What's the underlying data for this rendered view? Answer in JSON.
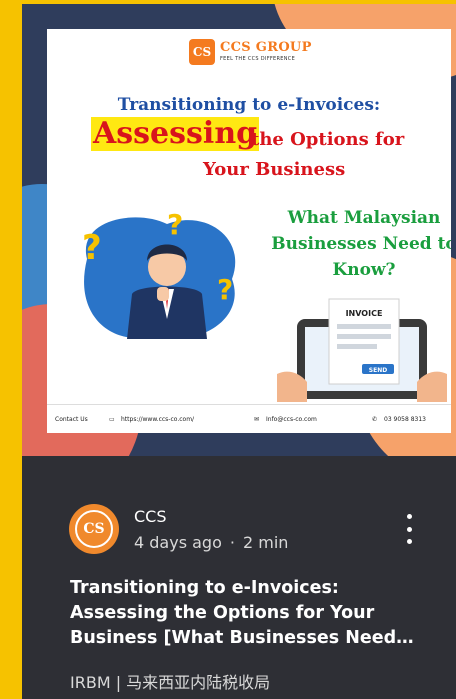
{
  "poster": {
    "logo_mark": "CS",
    "logo_name": "CCS GROUP",
    "logo_tagline": "FEEL THE CCS DIFFERENCE",
    "title_line1": "Transitioning to e-Invoices:",
    "title_highlight": "Assessing",
    "title_line2": "the Options for",
    "title_line3": "Your Business",
    "question": "What Malaysian Businesses Need to Know?",
    "invoice_label": "INVOICE",
    "send_label": "SEND",
    "footer": {
      "contact": "Contact Us",
      "website": "https://www.ccs-co.com/",
      "email": "Info@ccs-co.com",
      "phone": "03 9058 8313"
    }
  },
  "post": {
    "avatar_text": "CS",
    "author": "CCS",
    "time_ago": "4 days ago",
    "separator": "·",
    "read_time": "2 min",
    "title": "Transitioning to e-Invoices: Assessing the Options for Your Business [What Businesses Need…",
    "category": "IRBM | 马来西亚内陆税收局"
  },
  "colors": {
    "page_bg": "#f6c200",
    "card_bg": "#2e2f35",
    "brand_orange": "#f47a1f",
    "title_blue": "#1f4fa3",
    "accent_red": "#d8141c",
    "accent_green": "#1a9e3e"
  }
}
